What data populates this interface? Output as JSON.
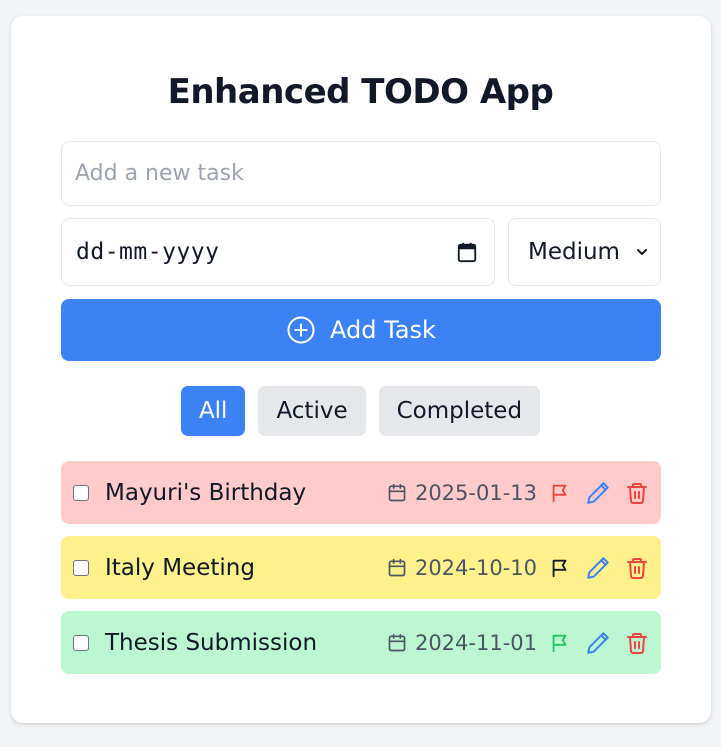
{
  "app": {
    "title": "Enhanced TODO App"
  },
  "form": {
    "task_placeholder": "Add a new task",
    "task_value": "",
    "date_display": "dd-mm-yyyy",
    "priority_selected": "Medium",
    "add_button_label": "Add Task"
  },
  "filters": {
    "all": "All",
    "active": "Active",
    "completed": "Completed",
    "selected": "All"
  },
  "tasks": [
    {
      "text": "Mayuri's Birthday",
      "date": "2025-01-13",
      "priority": "high",
      "completed": false
    },
    {
      "text": "Italy Meeting",
      "date": "2024-10-10",
      "priority": "medium",
      "completed": false
    },
    {
      "text": "Thesis Submission",
      "date": "2024-11-01",
      "priority": "low",
      "completed": false
    }
  ],
  "colors": {
    "accent": "#3b82f6",
    "high_bg": "#fecaca",
    "medium_bg": "#fef08a",
    "low_bg": "#bbf7d0",
    "high_flag": "#ef4444",
    "medium_flag": "#111827",
    "low_flag": "#22c55e",
    "edit_icon": "#3b82f6",
    "delete_icon": "#ef4444"
  },
  "icons": {
    "add": "plus-circle-icon",
    "date_picker": "calendar-icon",
    "select": "chevron-down-icon",
    "priority": "flag-icon",
    "edit": "pencil-icon",
    "delete": "trash-icon"
  }
}
